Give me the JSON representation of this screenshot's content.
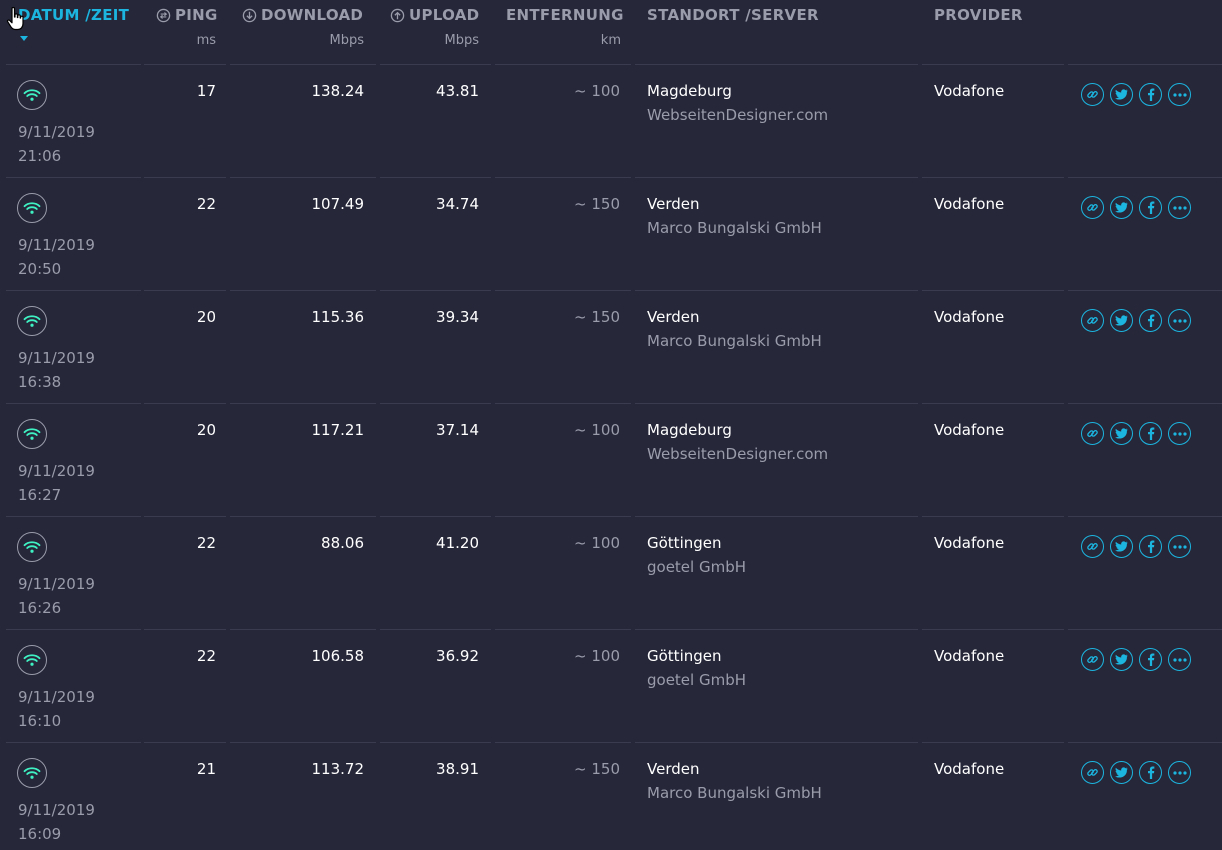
{
  "header": {
    "datum": "DATUM /ZEIT",
    "ping": "PING",
    "ping_unit": "ms",
    "download": "DOWNLOAD",
    "download_unit": "Mbps",
    "upload": "UPLOAD",
    "upload_unit": "Mbps",
    "entfernung": "ENTFERNUNG",
    "entfernung_unit": "km",
    "standort": "STANDORT /SERVER",
    "provider": "PROVIDER"
  },
  "colors": {
    "background": "#262739",
    "accent": "#1cb5e0",
    "wifi": "#3ff2c3",
    "muted": "#9a9cab"
  },
  "rows": [
    {
      "date": "9/11/2019",
      "time": "21:06",
      "ping": "17",
      "download": "138.24",
      "upload": "43.81",
      "distance": "~ 100",
      "city": "Magdeburg",
      "server": "WebseitenDesigner.com",
      "provider": "Vodafone"
    },
    {
      "date": "9/11/2019",
      "time": "20:50",
      "ping": "22",
      "download": "107.49",
      "upload": "34.74",
      "distance": "~ 150",
      "city": "Verden",
      "server": "Marco Bungalski GmbH",
      "provider": "Vodafone"
    },
    {
      "date": "9/11/2019",
      "time": "16:38",
      "ping": "20",
      "download": "115.36",
      "upload": "39.34",
      "distance": "~ 150",
      "city": "Verden",
      "server": "Marco Bungalski GmbH",
      "provider": "Vodafone"
    },
    {
      "date": "9/11/2019",
      "time": "16:27",
      "ping": "20",
      "download": "117.21",
      "upload": "37.14",
      "distance": "~ 100",
      "city": "Magdeburg",
      "server": "WebseitenDesigner.com",
      "provider": "Vodafone"
    },
    {
      "date": "9/11/2019",
      "time": "16:26",
      "ping": "22",
      "download": "88.06",
      "upload": "41.20",
      "distance": "~ 100",
      "city": "Göttingen",
      "server": "goetel GmbH",
      "provider": "Vodafone"
    },
    {
      "date": "9/11/2019",
      "time": "16:10",
      "ping": "22",
      "download": "106.58",
      "upload": "36.92",
      "distance": "~ 100",
      "city": "Göttingen",
      "server": "goetel GmbH",
      "provider": "Vodafone"
    },
    {
      "date": "9/11/2019",
      "time": "16:09",
      "ping": "21",
      "download": "113.72",
      "upload": "38.91",
      "distance": "~ 150",
      "city": "Verden",
      "server": "Marco Bungalski GmbH",
      "provider": "Vodafone"
    }
  ]
}
